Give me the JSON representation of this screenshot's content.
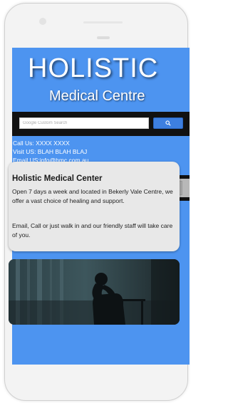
{
  "header": {
    "logo_title": "HOLISTIC",
    "logo_subtitle": "Medical Centre"
  },
  "search": {
    "placeholder": "Google Custom Search",
    "button_icon": "search-icon"
  },
  "contact": {
    "phone_line": "Call Us: XXXX XXXX",
    "visit_line": "Visit US: BLAH BLAH BLAJ",
    "email_line": "Email US:info@hmc.com.au"
  },
  "nav": {
    "menu_icon": "hamburger-menu-icon"
  },
  "intro_card": {
    "title": "Holistic Medical Center",
    "paragraph_1": "Open 7 days a week and located in Bekerly Vale Centre, we offer a vast choice of healing and support.",
    "paragraph_2": "Email, Call or just walk in and our friendly staff will take care of you."
  },
  "colors": {
    "header_blue": "#4d94f0",
    "bar_black": "#111111",
    "nav_gray": "#b8b8b8",
    "card_bg": "#e8e8e8",
    "search_button": "#3d7fe0"
  }
}
